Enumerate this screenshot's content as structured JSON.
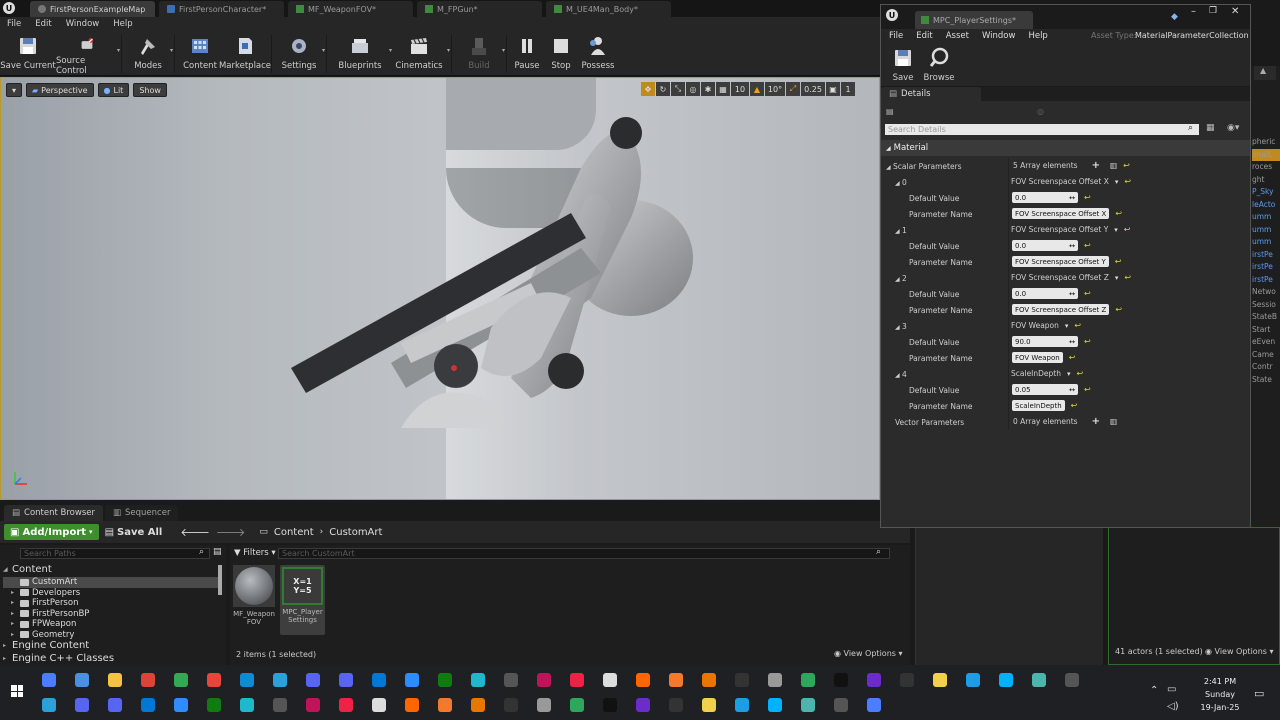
{
  "editor": {
    "doc_tabs": [
      "FirstPersonExampleMap",
      "FirstPersonCharacter*",
      "MF_WeaponFOV*",
      "M_FPGun*",
      "M_UE4Man_Body*"
    ],
    "menu": [
      "File",
      "Edit",
      "Window",
      "Help"
    ],
    "toolbar": [
      {
        "label": "Save Current",
        "icon": "save-icon"
      },
      {
        "label": "Source Control",
        "icon": "source-control-icon"
      },
      {
        "label": "Modes",
        "icon": "modes-icon"
      },
      {
        "label": "Content",
        "icon": "content-icon"
      },
      {
        "label": "Marketplace",
        "icon": "marketplace-icon"
      },
      {
        "label": "Settings",
        "icon": "settings-icon"
      },
      {
        "label": "Blueprints",
        "icon": "blueprints-icon"
      },
      {
        "label": "Cinematics",
        "icon": "cinematics-icon"
      },
      {
        "label": "Build",
        "icon": "build-icon"
      },
      {
        "label": "Pause",
        "icon": "pause-icon"
      },
      {
        "label": "Stop",
        "icon": "stop-icon"
      },
      {
        "label": "Possess",
        "icon": "possess-icon"
      }
    ],
    "viewport": {
      "perspective": "Perspective",
      "lit": "Lit",
      "show": "Show",
      "grid_snap": "10",
      "rot_snap": "10°",
      "scale_snap": "0.25",
      "extra_snap": "1"
    }
  },
  "content_browser": {
    "tabs": [
      "Content Browser",
      "Sequencer"
    ],
    "add_import": "Add/Import",
    "save_all": "Save All",
    "path": [
      "Content",
      "CustomArt"
    ],
    "search_paths_placeholder": "Search Paths",
    "filters": "Filters",
    "search_placeholder": "Search CustomArt",
    "tree": [
      {
        "label": "Content",
        "level": 0,
        "expanded": true
      },
      {
        "label": "CustomArt",
        "level": 1,
        "selected": true
      },
      {
        "label": "Developers",
        "level": 1
      },
      {
        "label": "FirstPerson",
        "level": 1
      },
      {
        "label": "FirstPersonBP",
        "level": 1
      },
      {
        "label": "FPWeapon",
        "level": 1
      },
      {
        "label": "Geometry",
        "level": 1
      },
      {
        "label": "Engine Content",
        "level": 0
      },
      {
        "label": "Engine C++ Classes",
        "level": 0
      }
    ],
    "assets": [
      {
        "name1": "MF_Weapon",
        "name2": "FOV",
        "type": "material-function"
      },
      {
        "name1": "MPC_Player",
        "name2": "Settings",
        "type": "parameter-collection",
        "selected": true,
        "glyph_top": "X=1",
        "glyph_bottom": "Y=5"
      }
    ],
    "status": "2 items (1 selected)",
    "view_options": "View Options"
  },
  "outliner": {
    "status": "41 actors (1 selected)",
    "view_options": "View Options",
    "side_items": [
      "pheric",
      "onalL",
      "roces",
      "ght",
      "P_Sky",
      "leActo",
      "umm",
      "umm",
      "umm",
      "irstPe",
      "irstPe",
      "irstPe",
      "Netwo",
      "Sessio",
      "StateB",
      "Start",
      "eEven",
      "Came",
      "Contr",
      "State"
    ]
  },
  "mpc_window": {
    "tab": "MPC_PlayerSettings*",
    "menu": [
      "File",
      "Edit",
      "Asset",
      "Window",
      "Help"
    ],
    "asset_type_label": "Asset Type:",
    "asset_type": "MaterialParameterCollection",
    "toolbar": [
      {
        "label": "Save",
        "icon": "save-icon"
      },
      {
        "label": "Browse",
        "icon": "browse-icon"
      }
    ],
    "details_tab": "Details",
    "search_placeholder": "Search Details",
    "category": "Material",
    "scalar_label": "Scalar Parameters",
    "scalar_count": "5 Array elements",
    "vector_label": "Vector Parameters",
    "vector_count": "0 Array elements",
    "default_value_label": "Default Value",
    "parameter_name_label": "Parameter Name",
    "params": [
      {
        "index": "0",
        "header": "FOV Screenspace Offset X",
        "default": "0.0",
        "name": "FOV Screenspace Offset X"
      },
      {
        "index": "1",
        "header": "FOV Screenspace Offset Y",
        "default": "0.0",
        "name": "FOV Screenspace Offset Y"
      },
      {
        "index": "2",
        "header": "FOV Screenspace Offset Z",
        "default": "0.0",
        "name": "FOV Screenspace Offset Z"
      },
      {
        "index": "3",
        "header": "FOV Weapon",
        "default": "90.0",
        "name": "FOV Weapon"
      },
      {
        "index": "4",
        "header": "ScaleInDepth",
        "default": "0.05",
        "name": "ScaleInDepth"
      }
    ]
  },
  "taskbar": {
    "time": "2:41 PM",
    "day": "Sunday",
    "date": "19-Jan-25"
  }
}
